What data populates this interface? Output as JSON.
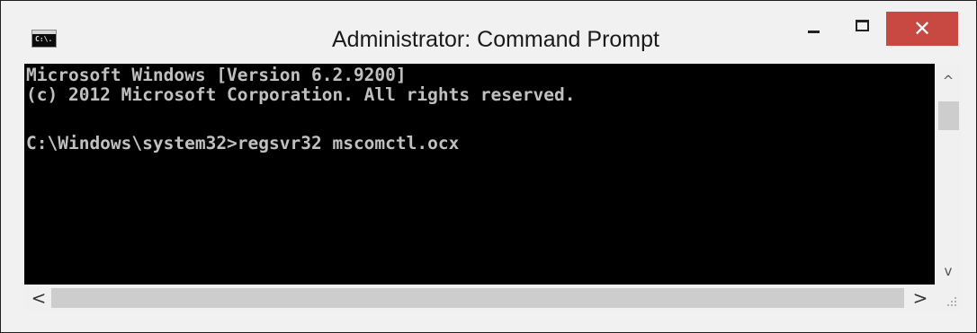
{
  "window": {
    "title": "Administrator: Command Prompt",
    "app_icon_text": "C:\\."
  },
  "window_controls": {
    "minimize": "minimize",
    "maximize": "maximize",
    "close_glyph": "✕",
    "close_color": "#c84842"
  },
  "console": {
    "background": "#000000",
    "text_color": "#c0c0c0",
    "lines": [
      "Microsoft Windows [Version 6.2.9200]",
      "(c) 2012 Microsoft Corporation. All rights reserved.",
      "",
      "C:\\Windows\\system32>regsvr32 mscomctl.ocx"
    ]
  },
  "scrollbars": {
    "up_glyph": "^",
    "down_glyph": "v",
    "left_glyph": "<",
    "right_glyph": ">"
  }
}
